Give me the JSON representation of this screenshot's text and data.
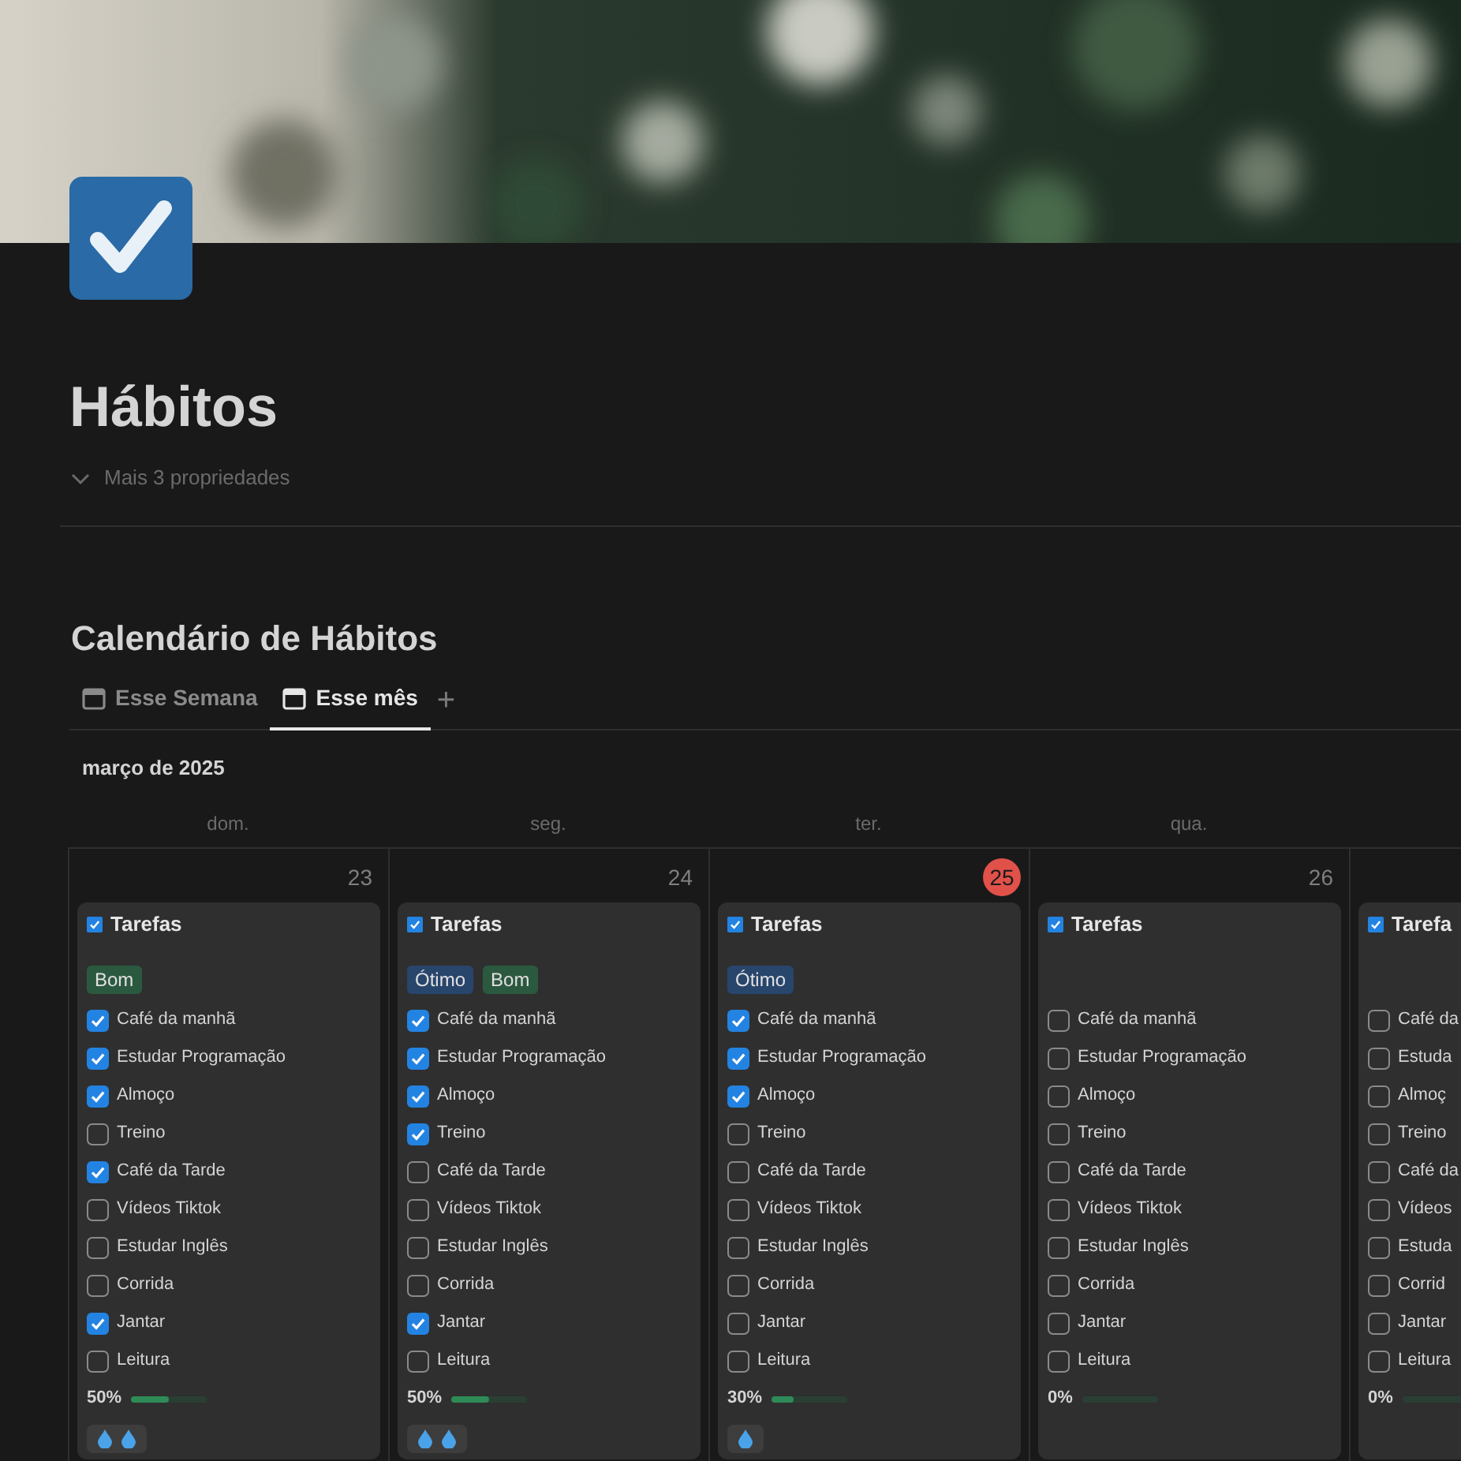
{
  "page": {
    "title": "Hábitos",
    "properties_toggle": "Mais 3 propriedades"
  },
  "calendar": {
    "title": "Calendário de Hábitos",
    "tabs": [
      {
        "label": "Esse Semana",
        "selected": false
      },
      {
        "label": "Esse mês",
        "selected": true
      }
    ],
    "add_tab": "+",
    "month": "março de 2025",
    "weekdays": [
      "dom.",
      "seg.",
      "ter.",
      "qua."
    ],
    "days": [
      {
        "day": "23",
        "today": false,
        "card": {
          "title": "Tarefas",
          "tags": [
            {
              "label": "Bom",
              "color": "#2b593f"
            }
          ],
          "tasks": [
            {
              "label": "Café da manhã",
              "checked": true
            },
            {
              "label": "Estudar Programação",
              "checked": true
            },
            {
              "label": "Almoço",
              "checked": true
            },
            {
              "label": "Treino",
              "checked": false
            },
            {
              "label": "Café da Tarde",
              "checked": true
            },
            {
              "label": "Vídeos Tiktok",
              "checked": false
            },
            {
              "label": "Estudar Inglês",
              "checked": false
            },
            {
              "label": "Corrida",
              "checked": false
            },
            {
              "label": "Jantar",
              "checked": true
            },
            {
              "label": "Leitura",
              "checked": false
            }
          ],
          "progress": "50%",
          "level": 0.5,
          "drops": [
            {
              "kind": "drop"
            },
            {
              "kind": "drop"
            }
          ]
        }
      },
      {
        "day": "24",
        "today": false,
        "card": {
          "title": "Tarefas",
          "tags": [
            {
              "label": "Ótimo",
              "color": "#28456c"
            },
            {
              "label": "Bom",
              "color": "#2b593f"
            }
          ],
          "tasks": [
            {
              "label": "Café da manhã",
              "checked": true
            },
            {
              "label": "Estudar Programação",
              "checked": true
            },
            {
              "label": "Almoço",
              "checked": true
            },
            {
              "label": "Treino",
              "checked": true
            },
            {
              "label": "Café da Tarde",
              "checked": false
            },
            {
              "label": "Vídeos Tiktok",
              "checked": false
            },
            {
              "label": "Estudar Inglês",
              "checked": false
            },
            {
              "label": "Corrida",
              "checked": false
            },
            {
              "label": "Jantar",
              "checked": true
            },
            {
              "label": "Leitura",
              "checked": false
            }
          ],
          "progress": "50%",
          "level": 0.5,
          "drops": [
            {
              "kind": "drop"
            },
            {
              "kind": "drop"
            }
          ]
        }
      },
      {
        "day": "25",
        "today": true,
        "card": {
          "title": "Tarefas",
          "tags": [
            {
              "label": "Ótimo",
              "color": "#28456c"
            }
          ],
          "tasks": [
            {
              "label": "Café da manhã",
              "checked": true
            },
            {
              "label": "Estudar Programação",
              "checked": true
            },
            {
              "label": "Almoço",
              "checked": true
            },
            {
              "label": "Treino",
              "checked": false
            },
            {
              "label": "Café da Tarde",
              "checked": false
            },
            {
              "label": "Vídeos Tiktok",
              "checked": false
            },
            {
              "label": "Estudar Inglês",
              "checked": false
            },
            {
              "label": "Corrida",
              "checked": false
            },
            {
              "label": "Jantar",
              "checked": false
            },
            {
              "label": "Leitura",
              "checked": false
            }
          ],
          "progress": "30%",
          "level": 0.3,
          "drops": [
            {
              "kind": "drop"
            }
          ]
        }
      },
      {
        "day": "26",
        "today": false,
        "card": {
          "title": "Tarefas",
          "tasks": [
            {
              "label": "Café da manhã",
              "checked": false
            },
            {
              "label": "Estudar Programação",
              "checked": false
            },
            {
              "label": "Almoço",
              "checked": false
            },
            {
              "label": "Treino",
              "checked": false
            },
            {
              "label": "Café da Tarde",
              "checked": false
            },
            {
              "label": "Vídeos Tiktok",
              "checked": false
            },
            {
              "label": "Estudar Inglês",
              "checked": false
            },
            {
              "label": "Corrida",
              "checked": false
            },
            {
              "label": "Jantar",
              "checked": false
            },
            {
              "label": "Leitura",
              "checked": false
            }
          ],
          "progress": "0%",
          "level": 0
        }
      },
      {
        "card": {
          "title": "Tarefa",
          "tasks": [
            {
              "label": "Café da",
              "checked": false
            },
            {
              "label": "Estuda",
              "checked": false
            },
            {
              "label": "Almoç",
              "checked": false
            },
            {
              "label": "Treino",
              "checked": false
            },
            {
              "label": "Café da",
              "checked": false
            },
            {
              "label": "Vídeos",
              "checked": false
            },
            {
              "label": "Estuda",
              "checked": false
            },
            {
              "label": "Corrid",
              "checked": false
            },
            {
              "label": "Jantar",
              "checked": false
            },
            {
              "label": "Leitura",
              "checked": false
            }
          ],
          "progress": "0%",
          "level": 0
        }
      }
    ]
  }
}
